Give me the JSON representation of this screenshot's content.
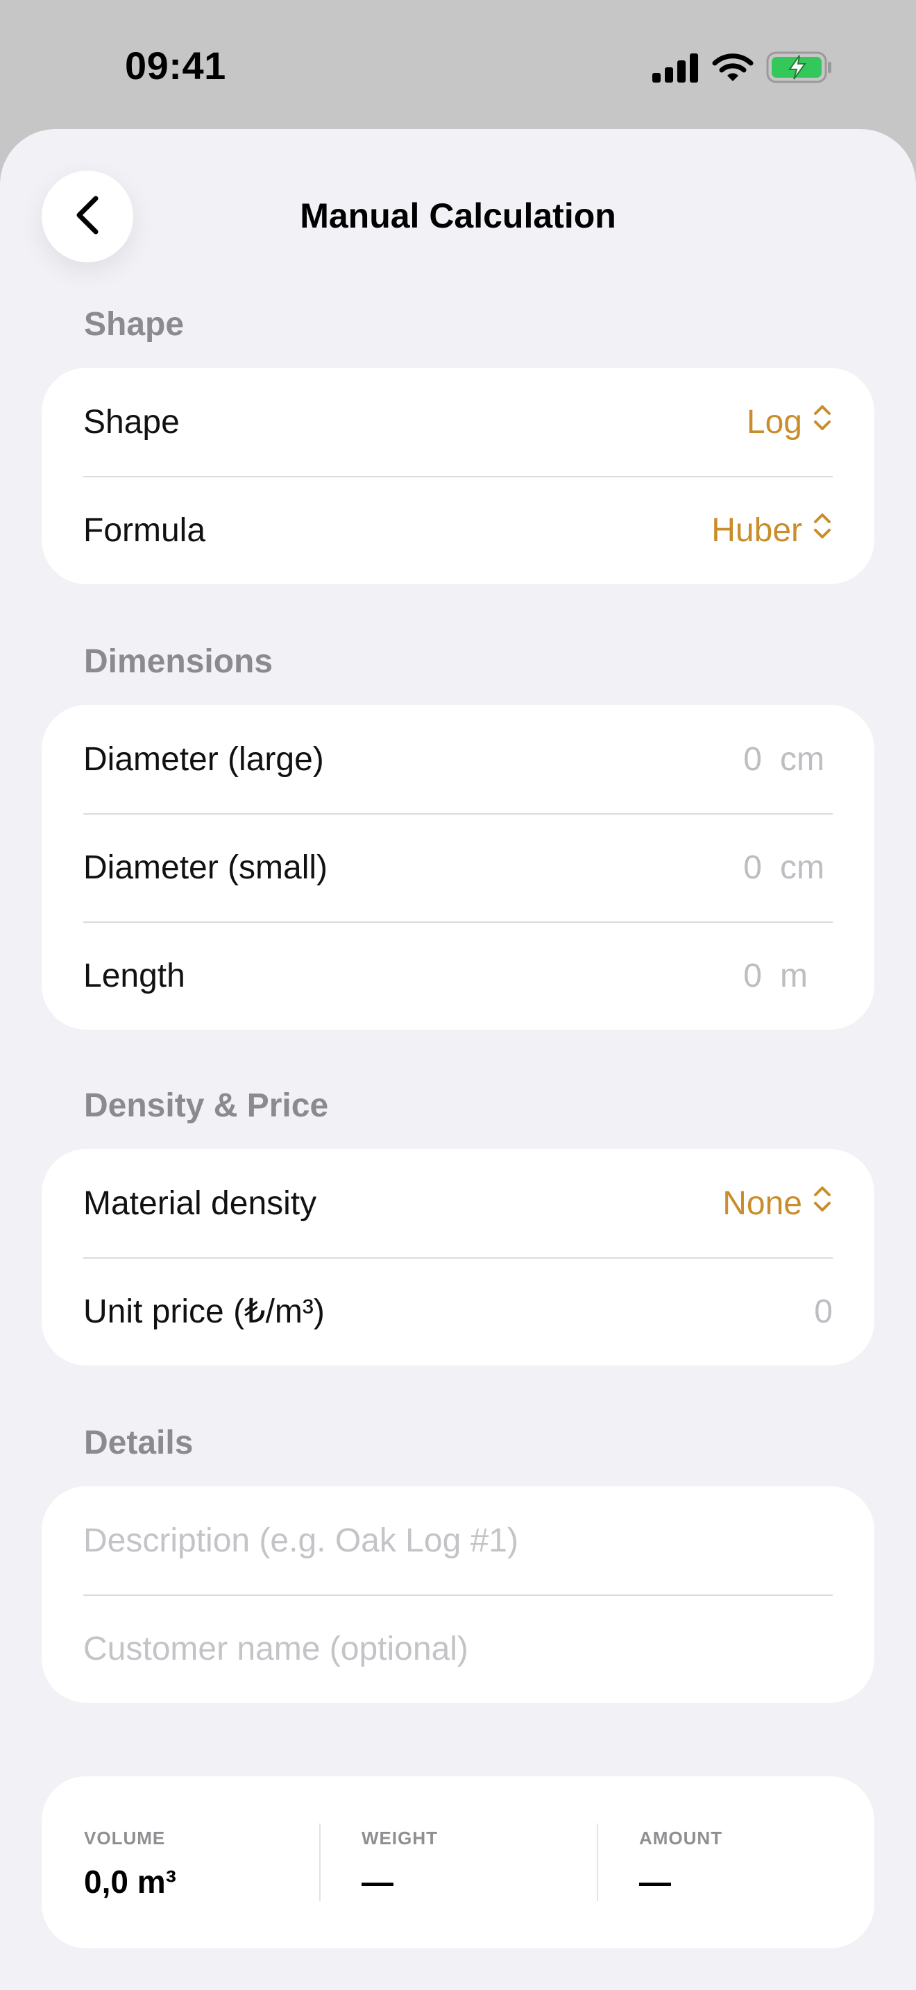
{
  "status_bar": {
    "time": "09:41"
  },
  "nav": {
    "title": "Manual Calculation"
  },
  "sections": {
    "shape": {
      "header": "Shape",
      "rows": [
        {
          "label": "Shape",
          "value": "Log"
        },
        {
          "label": "Formula",
          "value": "Huber"
        }
      ]
    },
    "dimensions": {
      "header": "Dimensions",
      "rows": [
        {
          "label": "Diameter (large)",
          "value": "0",
          "unit": "cm"
        },
        {
          "label": "Diameter (small)",
          "value": "0",
          "unit": "cm"
        },
        {
          "label": "Length",
          "value": "0",
          "unit": "m"
        }
      ]
    },
    "density_price": {
      "header": "Density & Price",
      "rows": [
        {
          "label": "Material density",
          "value": "None"
        },
        {
          "label": "Unit price (₺/m³)",
          "value": "0"
        }
      ]
    },
    "details": {
      "header": "Details",
      "description_placeholder": "Description (e.g. Oak Log #1)",
      "customer_placeholder": "Customer name (optional)"
    }
  },
  "summary": {
    "volume": {
      "label": "VOLUME",
      "value": "0,0 m³"
    },
    "weight": {
      "label": "WEIGHT",
      "value": "—"
    },
    "amount": {
      "label": "AMOUNT",
      "value": "—"
    }
  },
  "colors": {
    "accent": "#c98e2b",
    "background": "#f1f1f6",
    "battery": "#34c759"
  }
}
